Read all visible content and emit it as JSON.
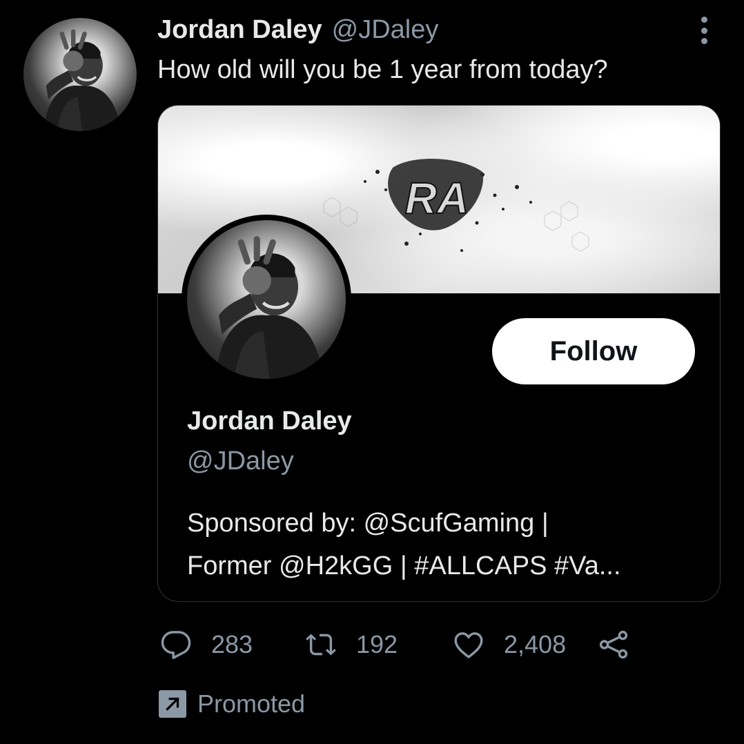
{
  "tweet": {
    "author_name": "Jordan Daley",
    "author_handle": "@JDaley",
    "text": "How old will you be 1 year from today?",
    "menu_icon": "more-vertical-icon"
  },
  "card": {
    "name": "Jordan Daley",
    "handle": "@JDaley",
    "follow_label": "Follow",
    "bio_line1": "Sponsored by: @ScufGaming |",
    "bio_line2": "Former @H2kGG | #ALLCAPS #Va...",
    "banner_logo_text": "RA"
  },
  "actions": {
    "reply_count": "283",
    "retweet_count": "192",
    "like_count": "2,408",
    "reply_icon": "reply-bubble-icon",
    "retweet_icon": "retweet-icon",
    "like_icon": "heart-icon",
    "share_icon": "share-icon"
  },
  "promoted": {
    "label": "Promoted",
    "icon": "promoted-arrow-icon"
  },
  "colors": {
    "background": "#000000",
    "text_primary": "#e7e9ea",
    "text_secondary": "#8b98a5",
    "border": "#2f3336",
    "button_bg": "#ffffff"
  }
}
